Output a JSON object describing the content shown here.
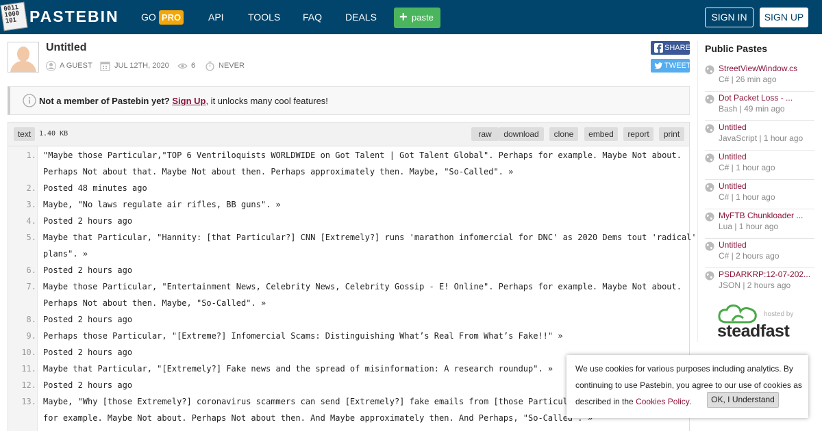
{
  "header": {
    "logo_digits": [
      "0011",
      "1000",
      "101"
    ],
    "logo_text": "PASTEBIN",
    "nav": {
      "go": "GO",
      "pro": "PRO",
      "api": "API",
      "tools": "TOOLS",
      "faq": "FAQ",
      "deals": "DEALS"
    },
    "paste_button": "paste",
    "sign_in": "SIGN IN",
    "sign_up": "SIGN UP"
  },
  "paste": {
    "title": "Untitled",
    "author": "A GUEST",
    "date": "JUL 12TH, 2020",
    "views": "6",
    "expires": "NEVER",
    "share_label": "SHARE",
    "tweet_label": "TWEET"
  },
  "notice": {
    "lead": "Not a member of Pastebin yet?",
    "link": "Sign Up",
    "rest": ", it unlocks many cool features!"
  },
  "code": {
    "syntax": "text",
    "size": "1.40 KB",
    "actions": [
      "raw",
      "download",
      "clone",
      "embed",
      "report",
      "print"
    ],
    "line_numbers": [
      "1.",
      "2.",
      "3.",
      "4.",
      "5.",
      "6.",
      "7.",
      "8.",
      "9.",
      "10.",
      "11.",
      "12.",
      "13."
    ],
    "visual_lines": [
      "\"Maybe those Particular,\"TOP 6 Ventriloquists WORLDWIDE on Got Talent | Got Talent Global\". Perhaps for example. Maybe Not about.",
      "Perhaps Not about that. Maybe Not about then. Perhaps approximately then. Maybe, \"So-Called\". »",
      "Posted 48 minutes ago",
      "Maybe, \"No laws regulate air rifles, BB guns\". »",
      "Posted 2 hours ago",
      "Maybe that Particular, \"Hannity: [that Particular?] CNN [Extremely?] runs 'marathon infomercial for DNC' as 2020 Dems tout 'radical'",
      "plans\". »",
      "Posted 2 hours ago",
      "Maybe those Particular, \"Entertainment News, Celebrity News, Celebrity Gossip - E! Online\". Perhaps for example. Maybe Not about.",
      "Perhaps Not about then. Maybe, \"So-Called\". »",
      "Posted 2 hours ago",
      "Perhaps those Particular, \"[Extreme?] Infomercial Scams: Distinguishing What’s Real From What’s Fake!!\" »",
      "Posted 2 hours ago",
      "Maybe that Particular, \"[Extremely?] Fake news and the spread of misinformation: A research roundup\". »",
      "Posted 2 hours ago",
      "Maybe, \"Why [those Extremely?] coronavirus scammers can send [Extremely?] fake emails from [those Particular?]",
      "for example. Maybe Not about. Perhaps Not about then. And Maybe approximately then. And Perhaps, \"So-Called\". »"
    ]
  },
  "sidebar": {
    "title": "Public Pastes",
    "items": [
      {
        "title": "StreetViewWindow.cs",
        "sub": "C# | 26 min ago"
      },
      {
        "title": "Dot Packet Loss - ...",
        "sub": "Bash | 49 min ago"
      },
      {
        "title": "Untitled",
        "sub": "JavaScript | 1 hour ago"
      },
      {
        "title": "Untitled",
        "sub": "C# | 1 hour ago"
      },
      {
        "title": "Untitled",
        "sub": "C# | 1 hour ago"
      },
      {
        "title": "MyFTB Chunkloader ...",
        "sub": "Lua | 1 hour ago"
      },
      {
        "title": "Untitled",
        "sub": "C# | 2 hours ago"
      },
      {
        "title": "PSDARKRP:12-07-202...",
        "sub": "JSON | 2 hours ago"
      }
    ],
    "hosted_by": "hosted by",
    "host_name": "steadfast"
  },
  "cookie": {
    "text": "We use cookies for various purposes including analytics. By continuing to use Pastebin, you agree to our use of cookies as described in the",
    "link": "Cookies Policy",
    "after": ".",
    "button": "OK, I Understand"
  },
  "colors": {
    "header_bg": "#02456c",
    "pro_badge": "#f4a60a",
    "paste_button": "#4bb55e",
    "link": "#8a1538",
    "facebook": "#3b5998",
    "twitter": "#55acee"
  }
}
